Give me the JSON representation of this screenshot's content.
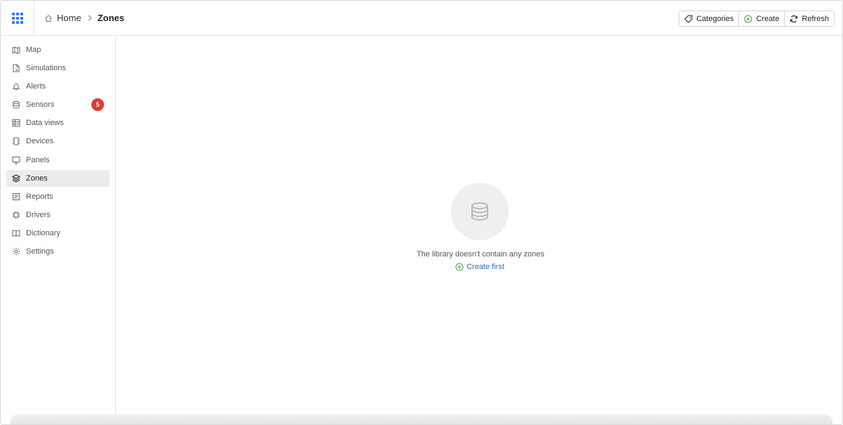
{
  "breadcrumb": {
    "home": "Home",
    "current": "Zones"
  },
  "toolbar": {
    "categories_label": "Categories",
    "create_label": "Create",
    "refresh_label": "Refresh"
  },
  "sidebar": {
    "items": [
      {
        "label": "Map",
        "icon": "map-icon"
      },
      {
        "label": "Simulations",
        "icon": "simulations-icon"
      },
      {
        "label": "Alerts",
        "icon": "bell-icon"
      },
      {
        "label": "Sensors",
        "icon": "database-icon",
        "badge": "5"
      },
      {
        "label": "Data views",
        "icon": "table-icon"
      },
      {
        "label": "Devices",
        "icon": "device-icon"
      },
      {
        "label": "Panels",
        "icon": "monitor-icon"
      },
      {
        "label": "Zones",
        "icon": "layers-icon",
        "active": true
      },
      {
        "label": "Reports",
        "icon": "report-icon"
      },
      {
        "label": "Drivers",
        "icon": "chip-icon"
      },
      {
        "label": "Dictionary",
        "icon": "book-icon"
      },
      {
        "label": "Settings",
        "icon": "gear-icon"
      }
    ]
  },
  "empty_state": {
    "message": "The library doesn't contain any zones",
    "action": "Create first",
    "icon": "database-icon"
  },
  "colors": {
    "accent": "#2f7de1",
    "badge": "#e23b2a",
    "link": "#2f6db5",
    "create_green": "#3aa83a"
  }
}
